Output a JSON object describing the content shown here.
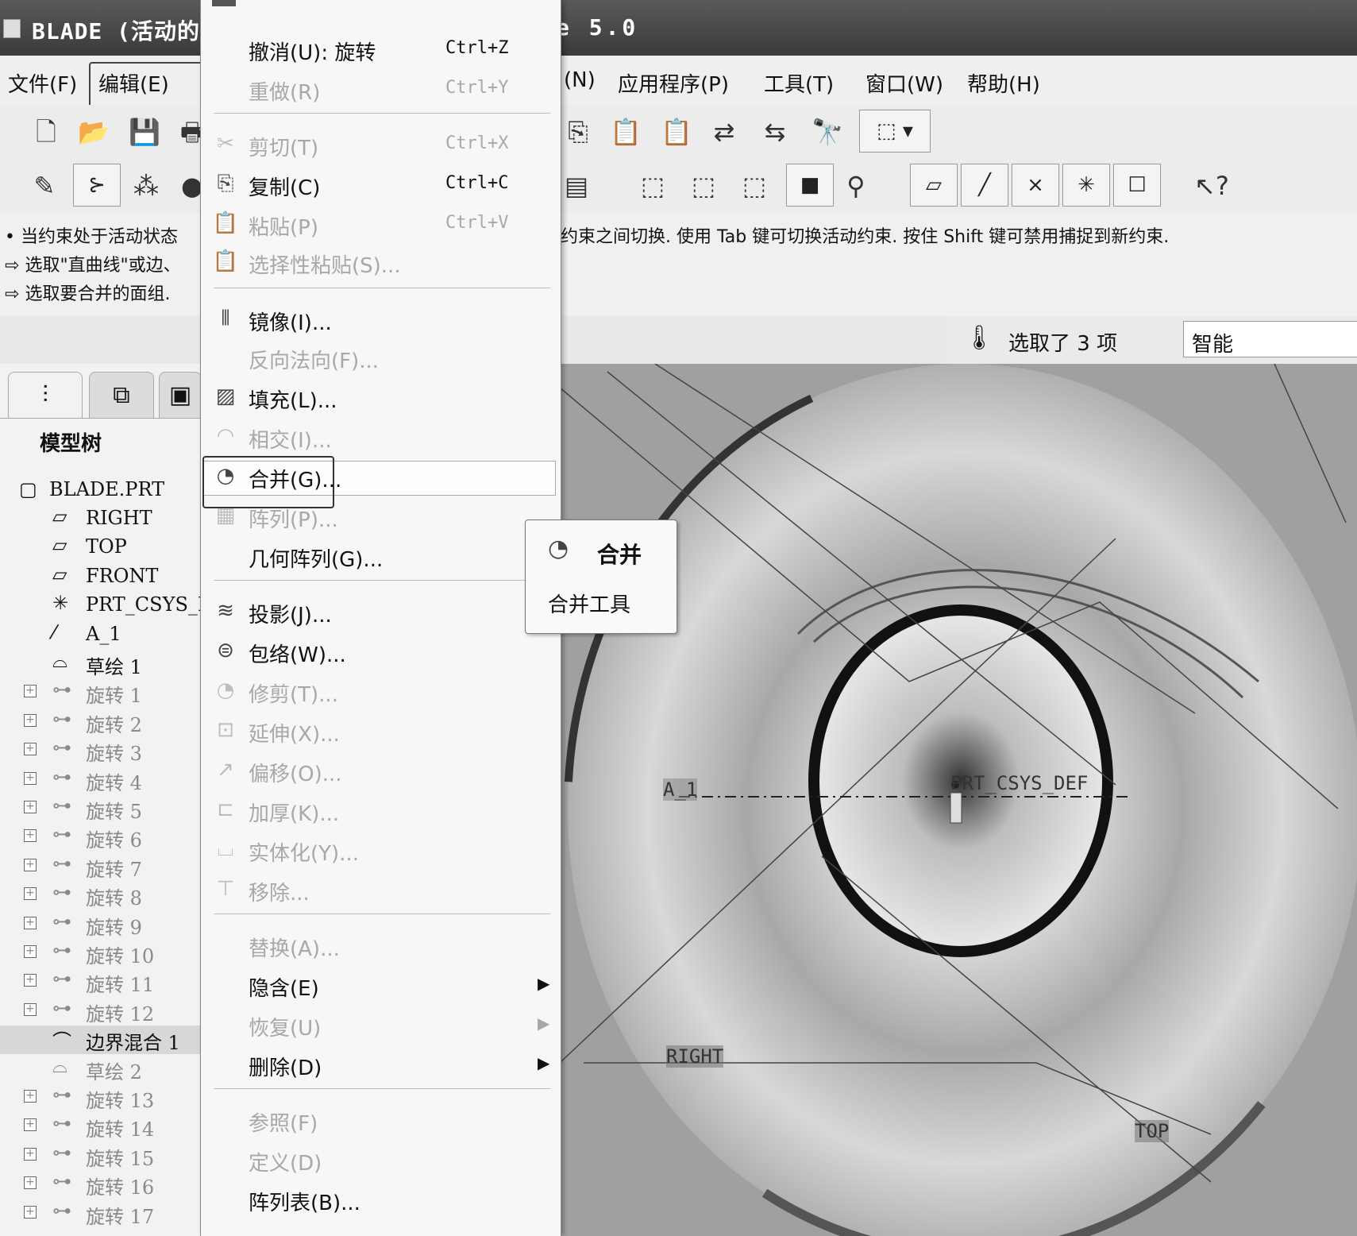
{
  "window": {
    "title_left": "BLADE (活动的",
    "title_right": "e 5.0"
  },
  "menubar": {
    "file": "文件(F)",
    "edit": "编辑(E)",
    "partial": "(N)",
    "applications": "应用程序(P)",
    "tools": "工具(T)",
    "window": "窗口(W)",
    "help": "帮助(H)"
  },
  "messages": {
    "line1_left": "当约束处于活动状态",
    "line1_right": "约束之间切换. 使用 Tab 键可切换活动约束. 按住 Shift 键可禁用捕捉到新约束.",
    "line2": "选取\"直曲线\"或边、",
    "line3": "选取要合并的面组."
  },
  "status": {
    "selected": "选取了 3 项",
    "filter": "智能"
  },
  "modeltree": {
    "header": "模型树",
    "root": "BLADE.PRT",
    "items": [
      {
        "label": "RIGHT",
        "icon": "datum-plane-icon",
        "dim": false,
        "plus": false
      },
      {
        "label": "TOP",
        "icon": "datum-plane-icon",
        "dim": false,
        "plus": false
      },
      {
        "label": "FRONT",
        "icon": "datum-plane-icon",
        "dim": false,
        "plus": false
      },
      {
        "label": "PRT_CSYS_DE",
        "icon": "csys-icon",
        "dim": false,
        "plus": false
      },
      {
        "label": "A_1",
        "icon": "axis-icon",
        "dim": false,
        "plus": false
      },
      {
        "label": "草绘 1",
        "icon": "sketch-icon",
        "dim": false,
        "plus": false
      },
      {
        "label": "旋转 1",
        "icon": "revolve-icon",
        "dim": true,
        "plus": true
      },
      {
        "label": "旋转 2",
        "icon": "revolve-icon",
        "dim": true,
        "plus": true
      },
      {
        "label": "旋转 3",
        "icon": "revolve-icon",
        "dim": true,
        "plus": true
      },
      {
        "label": "旋转 4",
        "icon": "revolve-icon",
        "dim": true,
        "plus": true
      },
      {
        "label": "旋转 5",
        "icon": "revolve-icon",
        "dim": true,
        "plus": true
      },
      {
        "label": "旋转 6",
        "icon": "revolve-icon",
        "dim": true,
        "plus": true
      },
      {
        "label": "旋转 7",
        "icon": "revolve-icon",
        "dim": true,
        "plus": true
      },
      {
        "label": "旋转 8",
        "icon": "revolve-icon",
        "dim": true,
        "plus": true
      },
      {
        "label": "旋转 9",
        "icon": "revolve-icon",
        "dim": true,
        "plus": true
      },
      {
        "label": "旋转 10",
        "icon": "revolve-icon",
        "dim": true,
        "plus": true
      },
      {
        "label": "旋转 11",
        "icon": "revolve-icon",
        "dim": true,
        "plus": true
      },
      {
        "label": "旋转 12",
        "icon": "revolve-icon",
        "dim": true,
        "plus": true
      },
      {
        "label": "边界混合 1",
        "icon": "boundary-blend-icon",
        "dim": false,
        "plus": false,
        "selected": true
      },
      {
        "label": "草绘 2",
        "icon": "sketch-icon",
        "dim": true,
        "plus": false
      },
      {
        "label": "旋转 13",
        "icon": "revolve-icon",
        "dim": true,
        "plus": true
      },
      {
        "label": "旋转 14",
        "icon": "revolve-icon",
        "dim": true,
        "plus": true
      },
      {
        "label": "旋转 15",
        "icon": "revolve-icon",
        "dim": true,
        "plus": true
      },
      {
        "label": "旋转 16",
        "icon": "revolve-icon",
        "dim": true,
        "plus": true
      },
      {
        "label": "旋转 17",
        "icon": "revolve-icon",
        "dim": true,
        "plus": true
      }
    ]
  },
  "editmenu": {
    "items": [
      {
        "label": "撤消(U): 旋转",
        "shortcut": "Ctrl+Z",
        "disabled": false,
        "icon": ""
      },
      {
        "label": "重做(R)",
        "shortcut": "Ctrl+Y",
        "disabled": true,
        "icon": ""
      },
      {
        "label": "剪切(T)",
        "shortcut": "Ctrl+X",
        "disabled": true,
        "icon": "cut-icon"
      },
      {
        "label": "复制(C)",
        "shortcut": "Ctrl+C",
        "disabled": false,
        "icon": "copy-icon"
      },
      {
        "label": "粘贴(P)",
        "shortcut": "Ctrl+V",
        "disabled": true,
        "icon": "paste-icon"
      },
      {
        "label": "选择性粘贴(S)...",
        "shortcut": "",
        "disabled": true,
        "icon": "paste-special-icon"
      },
      {
        "label": "镜像(I)...",
        "shortcut": "",
        "disabled": false,
        "icon": "mirror-icon"
      },
      {
        "label": "反向法向(F)...",
        "shortcut": "",
        "disabled": true,
        "icon": ""
      },
      {
        "label": "填充(L)...",
        "shortcut": "",
        "disabled": false,
        "icon": "fill-icon"
      },
      {
        "label": "相交(I)...",
        "shortcut": "",
        "disabled": true,
        "icon": "intersect-icon"
      },
      {
        "label": "合并(G)...",
        "shortcut": "",
        "disabled": false,
        "icon": "merge-icon"
      },
      {
        "label": "阵列(P)...",
        "shortcut": "",
        "disabled": true,
        "icon": "pattern-icon"
      },
      {
        "label": "几何阵列(G)...",
        "shortcut": "",
        "disabled": false,
        "icon": ""
      },
      {
        "label": "投影(J)...",
        "shortcut": "",
        "disabled": false,
        "icon": "project-icon"
      },
      {
        "label": "包络(W)...",
        "shortcut": "",
        "disabled": false,
        "icon": "wrap-icon"
      },
      {
        "label": "修剪(T)...",
        "shortcut": "",
        "disabled": true,
        "icon": "trim-icon"
      },
      {
        "label": "延伸(X)...",
        "shortcut": "",
        "disabled": true,
        "icon": "extend-icon"
      },
      {
        "label": "偏移(O)...",
        "shortcut": "",
        "disabled": true,
        "icon": "offset-icon"
      },
      {
        "label": "加厚(K)...",
        "shortcut": "",
        "disabled": true,
        "icon": "thicken-icon"
      },
      {
        "label": "实体化(Y)...",
        "shortcut": "",
        "disabled": true,
        "icon": "solidify-icon"
      },
      {
        "label": "移除...",
        "shortcut": "",
        "disabled": true,
        "icon": "remove-icon"
      },
      {
        "label": "替换(A)...",
        "shortcut": "",
        "disabled": true,
        "icon": ""
      },
      {
        "label": "隐含(E)",
        "shortcut": "",
        "disabled": false,
        "icon": "",
        "submenu": true
      },
      {
        "label": "恢复(U)",
        "shortcut": "",
        "disabled": true,
        "icon": "",
        "submenu": true
      },
      {
        "label": "删除(D)",
        "shortcut": "",
        "disabled": false,
        "icon": "",
        "submenu": true
      },
      {
        "label": "参照(F)",
        "shortcut": "",
        "disabled": true,
        "icon": ""
      },
      {
        "label": "定义(D)",
        "shortcut": "",
        "disabled": true,
        "icon": ""
      },
      {
        "label": "阵列表(B)...",
        "shortcut": "",
        "disabled": false,
        "icon": ""
      }
    ]
  },
  "tooltip": {
    "title": "合并",
    "desc": "合并工具"
  },
  "viewport": {
    "axis_label": "A_1",
    "csys_label": "PRT_CSYS_DEF",
    "right_label": "RIGHT",
    "top_label": "TOP"
  }
}
